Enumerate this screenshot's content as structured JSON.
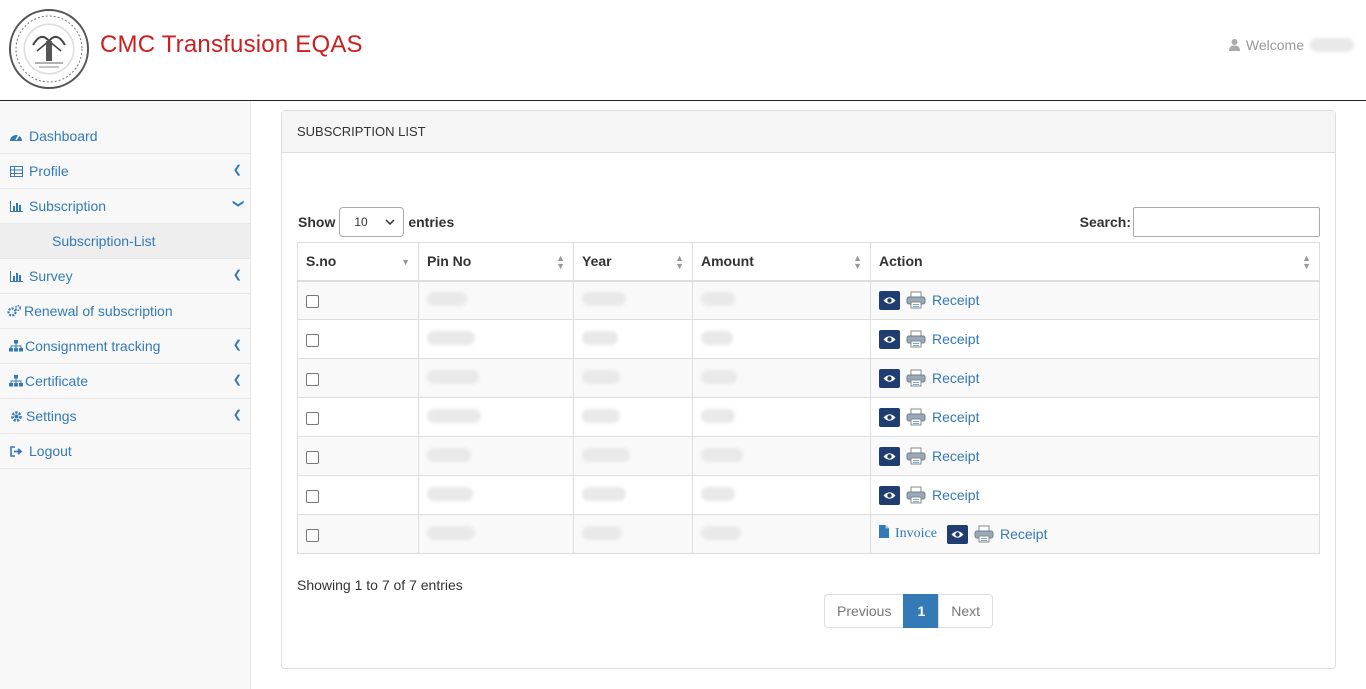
{
  "header": {
    "brand": "CMC Transfusion EQAS",
    "welcome_label": "Welcome"
  },
  "sidebar": {
    "items": [
      {
        "label": "Dashboard",
        "icon": "dashboard-icon"
      },
      {
        "label": "Profile",
        "icon": "table-icon"
      },
      {
        "label": "Subscription",
        "icon": "bar-chart-icon"
      },
      {
        "label": "Subscription-List"
      },
      {
        "label": "Survey",
        "icon": "bar-chart-icon"
      },
      {
        "label": "Renewal of subscription",
        "icon": "gears-icon"
      },
      {
        "label": "Consignment tracking",
        "icon": "sitemap-icon"
      },
      {
        "label": "Certificate",
        "icon": "sitemap-icon"
      },
      {
        "label": "Settings",
        "icon": "gear-icon"
      },
      {
        "label": "Logout",
        "icon": "sign-out-icon"
      }
    ]
  },
  "panel": {
    "title": "SUBSCRIPTION LIST",
    "show_label": "Show",
    "entries_label": "entries",
    "page_length": "10",
    "search_label": "Search:",
    "columns": [
      "S.no",
      "Pin No",
      "Year",
      "Amount",
      "Action"
    ],
    "receipt_label": "Receipt",
    "invoice_label": "Invoice",
    "info": "Showing 1 to 7 of 7 entries",
    "pagination": {
      "previous": "Previous",
      "current": "1",
      "next": "Next"
    }
  },
  "colors": {
    "brand": "#cc1f1f",
    "link": "#337ab7",
    "eye_button": "#1f3d70"
  }
}
